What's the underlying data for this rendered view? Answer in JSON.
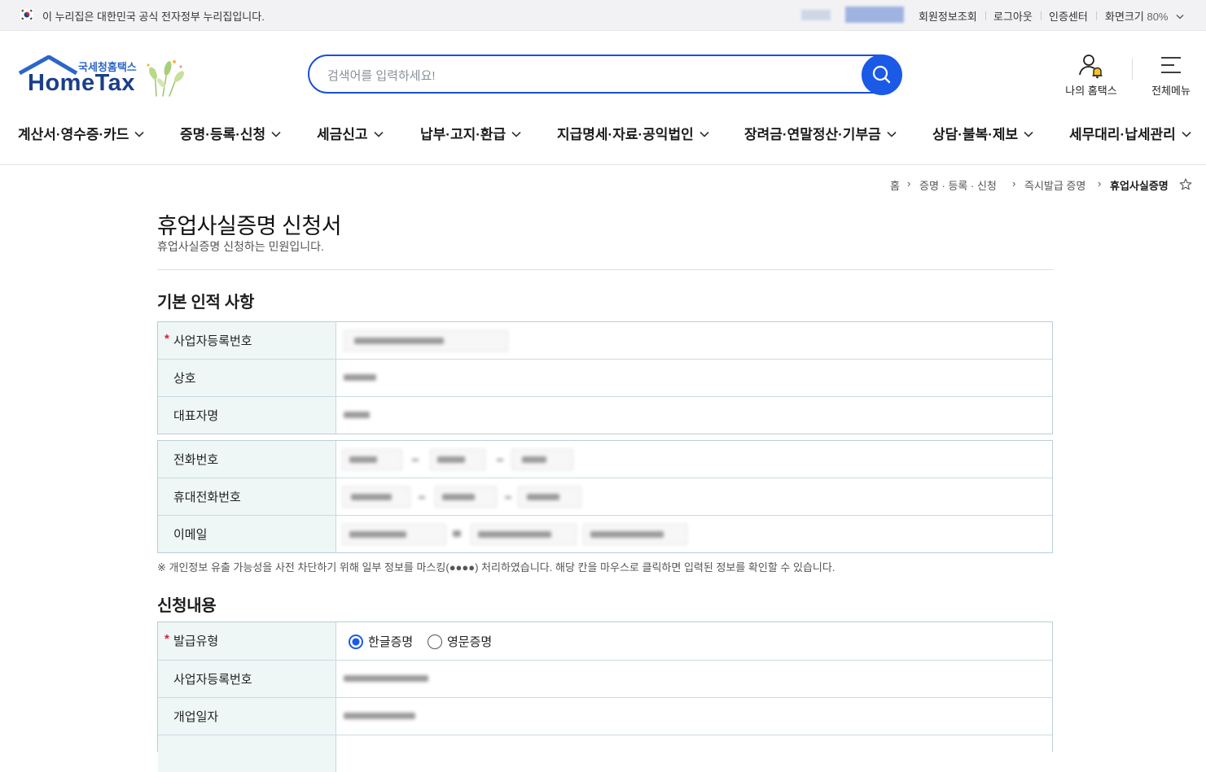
{
  "topbar": {
    "gov_notice": "이 누리집은 대한민국 공식 전자정부 누리집입니다.",
    "links": [
      "회원정보조회",
      "로그아웃",
      "인증센터"
    ],
    "zoom_label": "화면크기",
    "zoom_value": "80%"
  },
  "header": {
    "logo_sub": "국세청홈택스",
    "logo_main": "HomeTax",
    "search_placeholder": "검색어를 입력하세요!",
    "my_hometax": "나의 홈택스",
    "all_menu": "전체메뉴"
  },
  "gnb": [
    "계산서·영수증·카드",
    "증명·등록·신청",
    "세금신고",
    "납부·고지·환급",
    "지급명세·자료·공익법인",
    "장려금·연말정산·기부금",
    "상담·불복·제보",
    "세무대리·납세관리"
  ],
  "breadcrumb": [
    "홈",
    "증명 · 등록 · 신청",
    "즉시발급 증명",
    "휴업사실증명"
  ],
  "page": {
    "title": "휴업사실증명 신청서",
    "desc": "휴업사실증명 신청하는 민원입니다."
  },
  "basic": {
    "title": "기본 인적 사항",
    "rows1": [
      "사업자등록번호",
      "상호",
      "대표자명"
    ],
    "rows2": [
      "전화번호",
      "휴대전화번호",
      "이메일"
    ]
  },
  "notice": "※ 개인정보 유출 가능성을 사전 차단하기 위해 일부 정보를 마스킹(●●●●) 처리하였습니다. 해당 칸을 마우스로 클릭하면 입력된 정보를 확인할 수 있습니다.",
  "apply": {
    "title": "신청내용",
    "issue_type_label": "발급유형",
    "options": [
      "한글증명",
      "영문증명"
    ],
    "selected": "한글증명",
    "rows": [
      "사업자등록번호",
      "개업일자"
    ]
  },
  "colors": {
    "accent": "#1a5ae6",
    "table_header_bg": "#eef6f6",
    "table_border": "#b9cfd6",
    "required": "#d9232d"
  }
}
